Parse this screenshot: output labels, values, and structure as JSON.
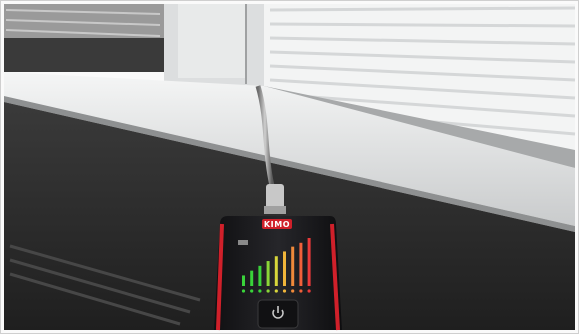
{
  "scene": {
    "description_free": true,
    "device": {
      "brand_label": "KIMO",
      "led_count": 9,
      "led_colors": [
        "#39d33a",
        "#39d33a",
        "#39d33a",
        "#8bd638",
        "#d8d63b",
        "#f0b53a",
        "#f08a3a",
        "#f0603a",
        "#e83a3a"
      ],
      "led_levels": [
        0.22,
        0.32,
        0.42,
        0.52,
        0.62,
        0.72,
        0.82,
        0.9,
        1.0
      ],
      "power_button_icon": "power-icon",
      "accent_color": "#d0202a",
      "body_color": "#1b1b1d"
    },
    "colors": {
      "wall": "#2e2e2e",
      "sill": "#e6e8e9",
      "window_frame": "#dcdedf",
      "blinds": "#f3f4f4"
    }
  }
}
